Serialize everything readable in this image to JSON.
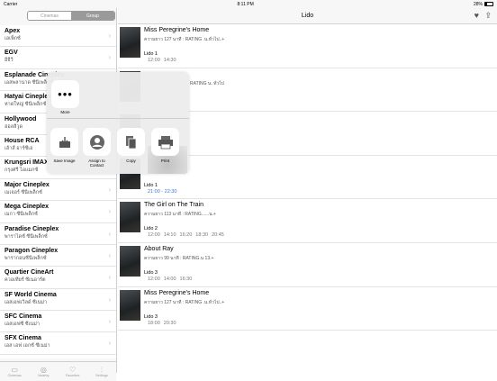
{
  "status_bar": {
    "carrier": "Carrier",
    "time": "8:11 PM",
    "battery": "28%"
  },
  "segmented": {
    "cinemas": "Cinemas",
    "group": "Group"
  },
  "cinemas": [
    {
      "en": "Apex",
      "th": "เอเพ็กซ์"
    },
    {
      "en": "EGV",
      "th": "อีจีวี"
    },
    {
      "en": "Esplanade Cineplex",
      "th": "เอสพลานาด ซีนีเพล็กซ์"
    },
    {
      "en": "Hatyai Cineplex",
      "th": "หาดใหญ่ ซีนีเพล็กซ์"
    },
    {
      "en": "Hollywood",
      "th": "ฮอลลีวูด"
    },
    {
      "en": "House RCA",
      "th": "เฮ้าส์ อาร์ซีเอ"
    },
    {
      "en": "Krungsri IMAX",
      "th": "กรุงศรี ไอแมกซ์"
    },
    {
      "en": "Major Cineplex",
      "th": "เมเจอร์ ซีนีเพล็กซ์"
    },
    {
      "en": "Mega Cineplex",
      "th": "เมกา ซีนีเพล็กซ์"
    },
    {
      "en": "Paradise Cineplex",
      "th": "พาราไดซ์ ซีนีเพล็กซ์"
    },
    {
      "en": "Paragon Cineplex",
      "th": "พารากอนซีนีเพล็กซ์"
    },
    {
      "en": "Quartier CineArt",
      "th": "ควอเทียร์ ซีเนอาร์ต"
    },
    {
      "en": "SF World Cinema",
      "th": "เอสเอฟเวิลด์ ซีเนม่า"
    },
    {
      "en": "SFC Cinema",
      "th": "เอสเอฟซี ซีเนม่า"
    },
    {
      "en": "SFX Cinema",
      "th": "เอส เอฟ เอกซ์ ซีเนม่า"
    }
  ],
  "tabbar": [
    "Cinemas",
    "Nearby",
    "Favorites",
    "Settings"
  ],
  "nav": {
    "title": "Lido"
  },
  "movies": [
    {
      "title": "Miss Peregrine's Home",
      "info": "ความยาว 127 นาที : RATING .น.ทั่วไป..+",
      "hall": "Lido 1",
      "times": [
        "12:00",
        "14:30"
      ],
      "highlight": false
    },
    {
      "title": "",
      "info": "RATING น. ทั่วไป",
      "hall": "",
      "times": [],
      "highlight": false
    },
    {
      "title": "",
      "info": "",
      "hall": "",
      "times": [],
      "highlight": false
    },
    {
      "title": "",
      "info": "",
      "hall": "Lido 1",
      "times": [
        "21:00 - 22:30"
      ],
      "highlight": true
    },
    {
      "title": "The Girl on The Train",
      "info": "ความยาว 113 นาที : RATING......น.+",
      "hall": "Lido 2",
      "times": [
        "12:00",
        "14:10",
        "16:20",
        "18:30",
        "20:45"
      ],
      "highlight": false
    },
    {
      "title": "About Ray",
      "info": "ความยาว 99 นาที : RATING.น 13.+",
      "hall": "Lido 3",
      "times": [
        "12:00",
        "14:00",
        "16:30"
      ],
      "highlight": false
    },
    {
      "title": "Miss Peregrine's Home",
      "info": "ความยาว 127 นาที : RATING .น.ทั่วไป..+",
      "hall": "Lido 3",
      "times": [
        "18:00",
        "20:30"
      ],
      "highlight": false
    }
  ],
  "share_sheet": {
    "more": "More",
    "actions": [
      {
        "label": "Save Image",
        "icon": "save-image-icon"
      },
      {
        "label": "Assign to Contact",
        "icon": "contact-icon"
      },
      {
        "label": "Copy",
        "icon": "copy-icon"
      },
      {
        "label": "Print",
        "icon": "print-icon"
      }
    ]
  }
}
